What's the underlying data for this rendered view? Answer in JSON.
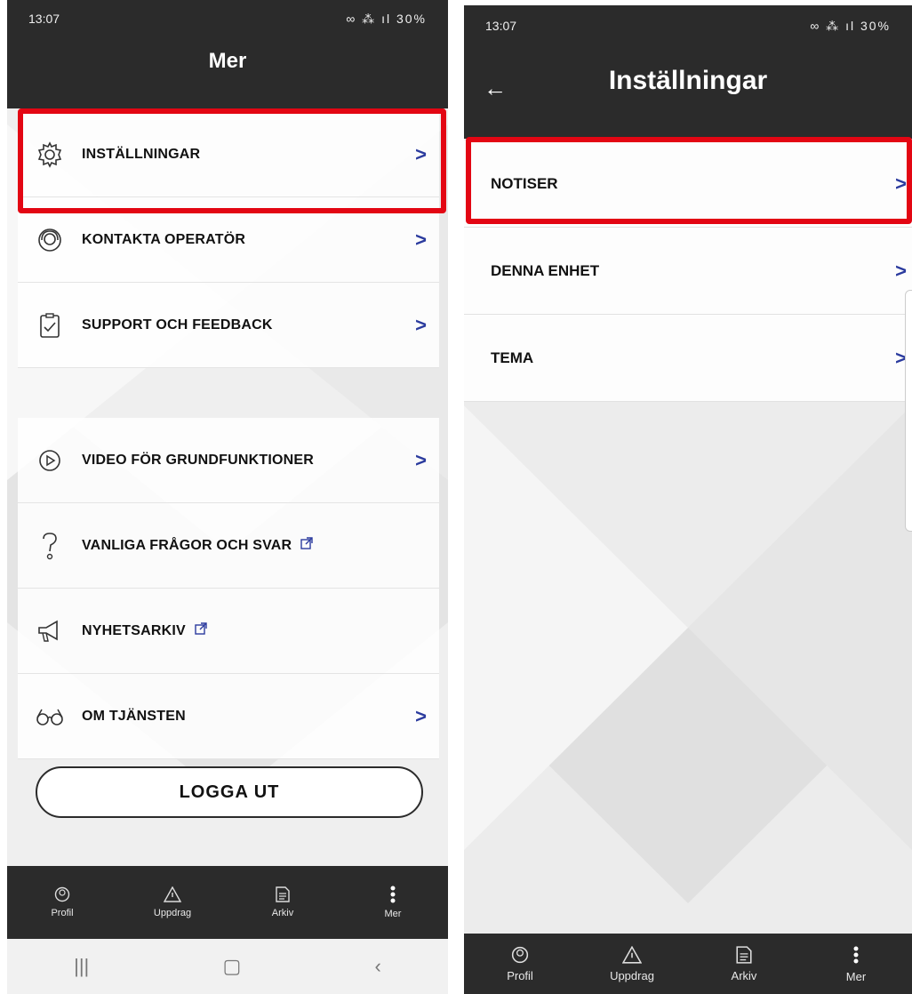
{
  "left": {
    "status": {
      "time": "13:07",
      "battery": "30%"
    },
    "title": "Mer",
    "menu": [
      {
        "label": "INSTÄLLNINGAR",
        "icon": "gear-icon",
        "trailing": "chevron"
      },
      {
        "label": "KONTAKTA OPERATÖR",
        "icon": "operator-headset-icon",
        "trailing": "chevron"
      },
      {
        "label": "SUPPORT OCH FEEDBACK",
        "icon": "clipboard-check-icon",
        "trailing": "chevron"
      },
      {
        "label": "VIDEO FÖR GRUNDFUNKTIONER",
        "icon": "play-circle-icon",
        "trailing": "chevron"
      },
      {
        "label": "VANLIGA FRÅGOR OCH SVAR",
        "icon": "question-icon",
        "trailing": "external"
      },
      {
        "label": "NYHETSARKIV",
        "icon": "megaphone-icon",
        "trailing": "external"
      },
      {
        "label": "OM TJÄNSTEN",
        "icon": "glasses-icon",
        "trailing": "chevron"
      }
    ],
    "logout_label": "LOGGA UT",
    "nav": [
      "Profil",
      "Uppdrag",
      "Arkiv",
      "Mer"
    ]
  },
  "right": {
    "status": {
      "time": "13:07",
      "battery": "30%"
    },
    "title": "Inställningar",
    "rows": [
      "NOTISER",
      "DENNA ENHET",
      "TEMA"
    ],
    "nav": [
      "Profil",
      "Uppdrag",
      "Arkiv",
      "Mer"
    ]
  },
  "colors": {
    "bar": "#2b2b2b",
    "highlight": "#e30613",
    "chevron": "#2b3b9e"
  }
}
